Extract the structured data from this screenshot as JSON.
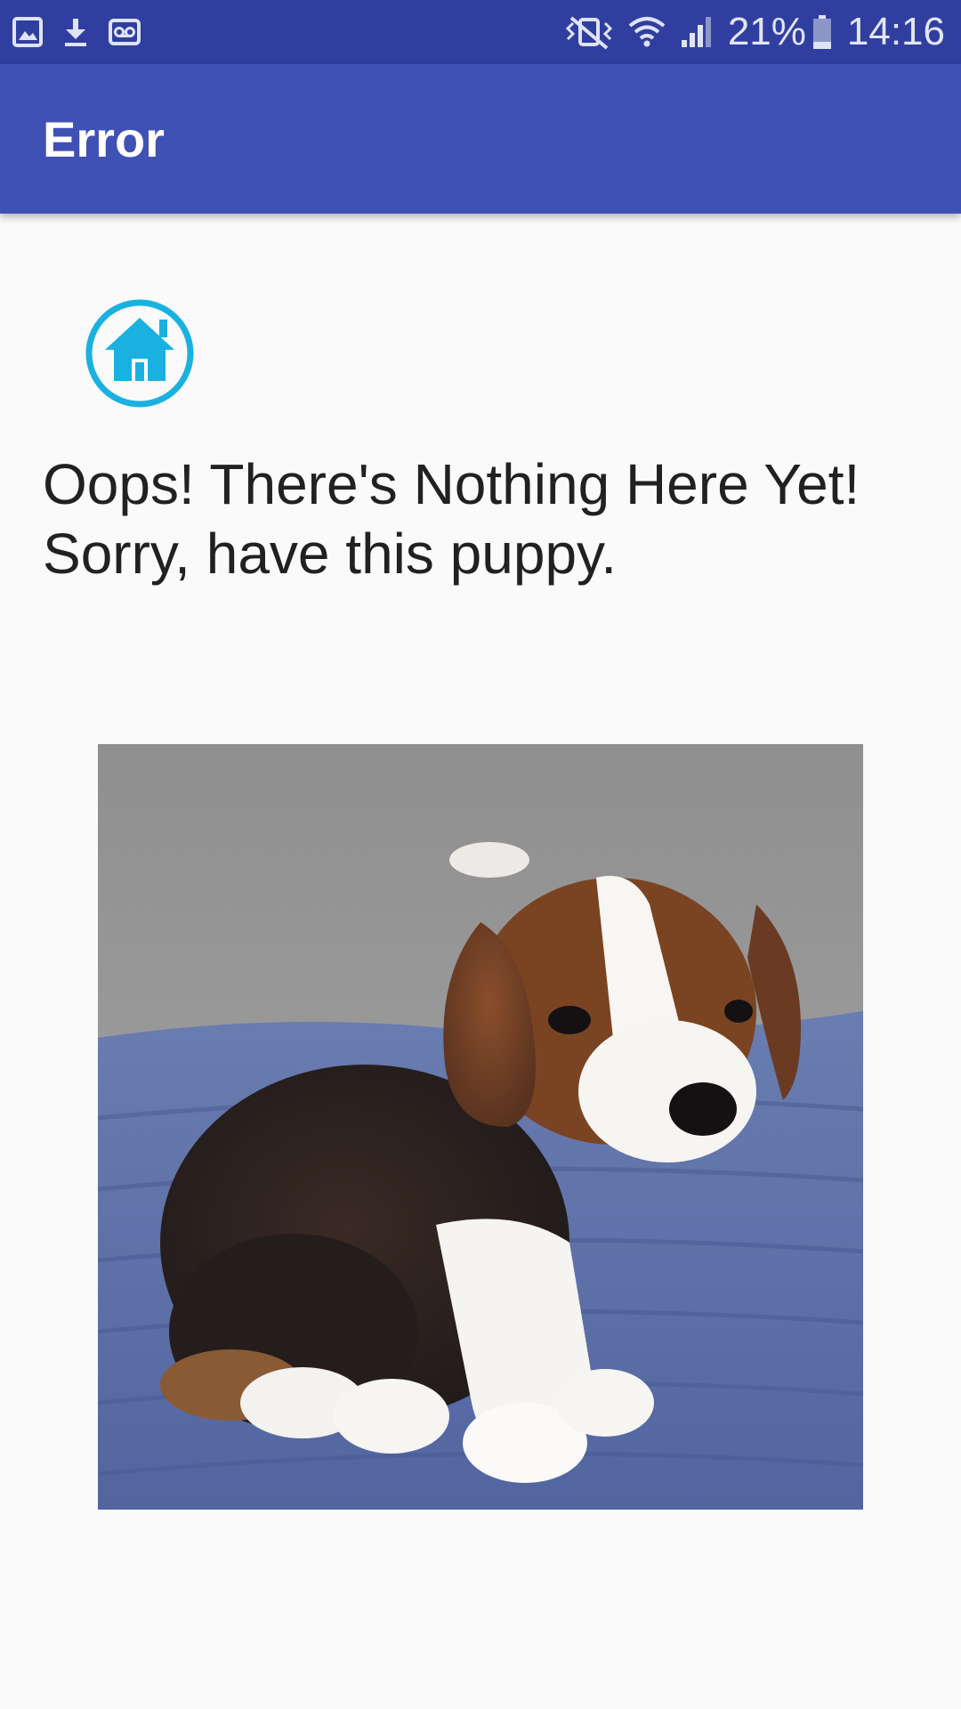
{
  "status_bar": {
    "left_icons": [
      "gallery-icon",
      "download-icon",
      "voicemail-icon"
    ],
    "right_icons": [
      "vibrate-mute-icon",
      "wifi-icon",
      "signal-icon",
      "battery-icon"
    ],
    "battery": "21%",
    "time": "14:16"
  },
  "app_bar": {
    "title": "Error",
    "color": "#3f51b5"
  },
  "home": {
    "icon": "home-icon",
    "color": "#1ab1e0"
  },
  "message": {
    "line1": "Oops! There's Nothing Here Yet!",
    "line2": "Sorry, have this puppy."
  },
  "image": {
    "subject": "beagle puppy sitting on a blue blanket"
  }
}
